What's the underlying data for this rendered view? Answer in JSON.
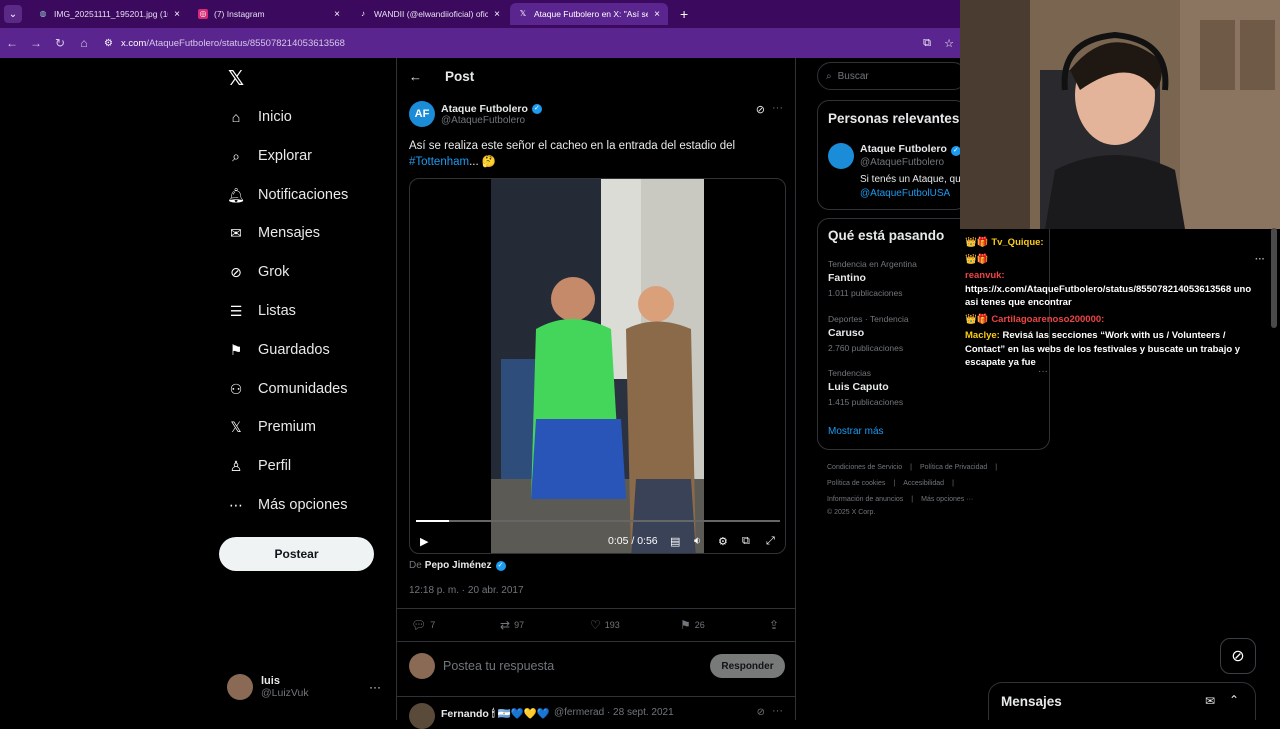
{
  "browser": {
    "tabs": [
      {
        "title": "IMG_20251111_195201.jpg (10",
        "active": false,
        "icon": "globe-icon"
      },
      {
        "title": "(7) Instagram",
        "active": false,
        "icon": "instagram-icon"
      },
      {
        "title": "WANDII (@elwandiioficial) ofici",
        "active": false,
        "icon": "tiktok-icon"
      },
      {
        "title": "Ataque Futbolero en X: \"Así se",
        "active": true,
        "icon": "x-icon"
      }
    ],
    "url_host": "x.com",
    "url_path": "/AtaqueFutbolero/status/855078214053613568"
  },
  "sidebar": {
    "items": [
      {
        "label": "Inicio",
        "icon": "home-icon"
      },
      {
        "label": "Explorar",
        "icon": "search-icon"
      },
      {
        "label": "Notificaciones",
        "icon": "bell-icon"
      },
      {
        "label": "Mensajes",
        "icon": "mail-icon"
      },
      {
        "label": "Grok",
        "icon": "grok-icon"
      },
      {
        "label": "Listas",
        "icon": "list-icon"
      },
      {
        "label": "Guardados",
        "icon": "bookmark-icon"
      },
      {
        "label": "Comunidades",
        "icon": "community-icon"
      },
      {
        "label": "Premium",
        "icon": "x-icon"
      },
      {
        "label": "Perfil",
        "icon": "person-icon"
      },
      {
        "label": "Más opciones",
        "icon": "more-circle-icon"
      }
    ],
    "post_button": "Postear",
    "account": {
      "name": "luis",
      "handle": "@LuizVuk"
    }
  },
  "post": {
    "header": "Post",
    "author_name": "Ataque Futbolero",
    "author_handle": "@AtaqueFutbolero",
    "text": "Así se realiza este señor el cacheo en la entrada del estadio del",
    "hashtag": "#Tottenham",
    "text_suffix": "... 🤔",
    "video": {
      "time": "0:05 / 0:56",
      "progress": 0.09
    },
    "from_label": "De",
    "from_name": "Pepo Jiménez",
    "timestamp": "12:18 p. m. · 20 abr. 2017",
    "metrics": {
      "replies": "7",
      "reposts": "97",
      "likes": "193",
      "bookmarks": "26"
    },
    "reply_placeholder": "Postea tu respuesta",
    "reply_button": "Responder"
  },
  "next_post": {
    "name": "Fernando 🕯 🇦🇷💙💛💙",
    "handle": "@fermerad · 28 sept. 2021"
  },
  "right": {
    "search_placeholder": "Buscar",
    "relevant_title": "Personas relevantes",
    "relevant": {
      "name": "Ataque Futbolero",
      "handle": "@AtaqueFutbolero",
      "bio": "Si tenés un Ataque, qu",
      "bio_link": "@AtaqueFutbolUSA"
    },
    "trends_title": "Qué está pasando",
    "trends": [
      {
        "context": "Tendencia en Argentina",
        "name": "Fantino",
        "posts": "1.011 publicaciones"
      },
      {
        "context": "Deportes · Tendencia",
        "name": "Caruso",
        "posts": "2.760 publicaciones"
      },
      {
        "context": "Tendencias",
        "name": "Luis Caputo",
        "posts": "1.415 publicaciones"
      }
    ],
    "show_more": "Mostrar más",
    "footer_lines": [
      [
        "Condiciones de Servicio",
        "Política de Privacidad"
      ],
      [
        "Política de cookies",
        "Accesibilidad"
      ],
      [
        "Información de anuncios",
        "Más opciones ···"
      ],
      [
        "© 2025 X Corp."
      ]
    ]
  },
  "chat": [
    {
      "badges": "👑🎁",
      "user": "Tv_Quique:",
      "text": "",
      "user_color": "#facc15"
    },
    {
      "badges": "👑🎁",
      "user": "",
      "text": "",
      "user_color": "#facc15"
    },
    {
      "badges": "",
      "user": "reanvuk:",
      "text": "https://x.com/AtaqueFutbolero/status/855078214053613568 uno asi tenes que encontrar",
      "user_color": "#ef4444"
    },
    {
      "badges": "👑🎁",
      "user": "Cartilagoarenoso200000:",
      "text": "",
      "user_color": "#ef4444"
    },
    {
      "badges": "",
      "user": "Maclye:",
      "text": "Revisá las secciones “Work with us / Volunteers / Contact” en las webs de los festivales y buscate un trabajo y escapate ya fue",
      "user_color": "#facc15"
    }
  ],
  "messages_drawer": {
    "title": "Mensajes"
  }
}
